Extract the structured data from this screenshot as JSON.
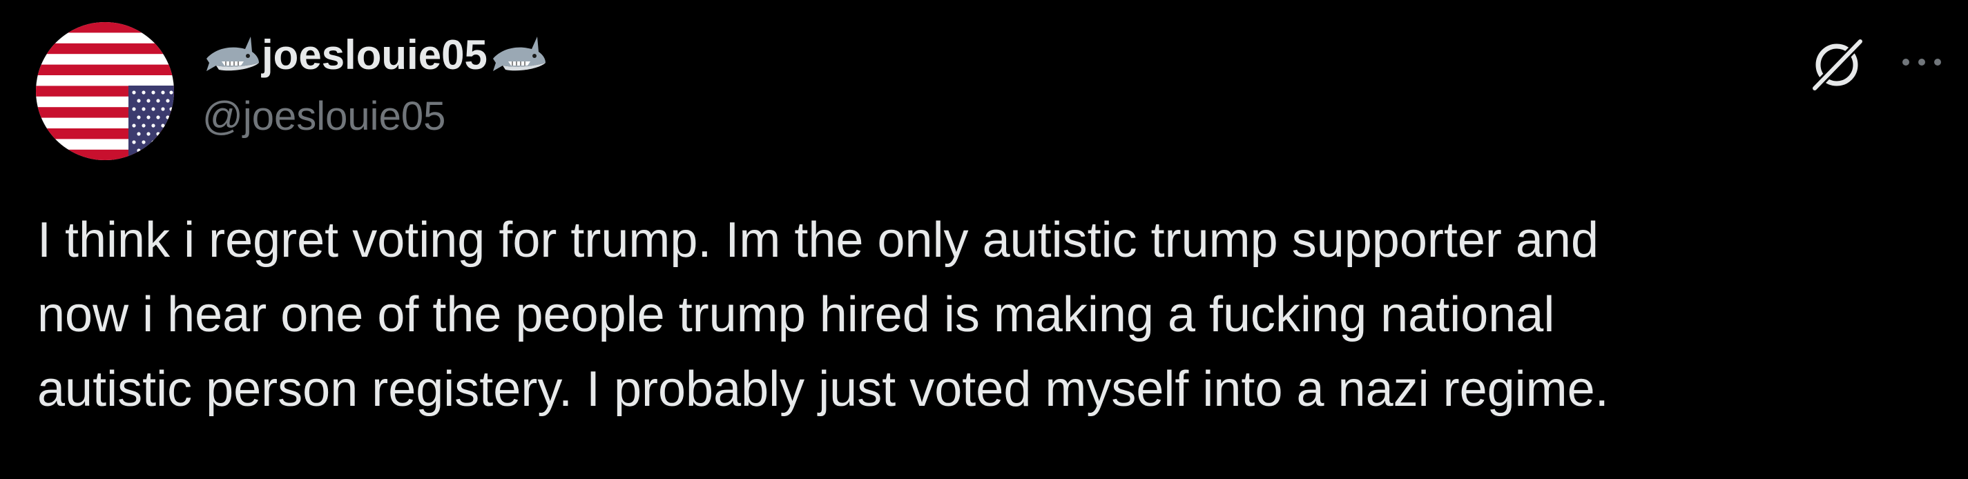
{
  "post": {
    "author": {
      "display_name": "joeslouie05",
      "handle": "@joeslouie05",
      "name_emoji_left": "shark-icon",
      "name_emoji_right": "shark-icon",
      "avatar": "us-flag-avatar"
    },
    "text_lines": [
      "I think i regret voting for trump. Im the only autistic trump supporter and",
      "now i hear one of the people trump hired is making a fucking national",
      "autistic person registery. I probably just voted myself into a nazi regime."
    ],
    "actions": {
      "grok_icon": "grok-icon",
      "more_icon": "more-options-icon"
    }
  },
  "colors": {
    "background": "#000000",
    "primary_text": "#e7e9ea",
    "secondary_text": "#71767b",
    "flag_red": "#c8102e",
    "flag_blue": "#3c3b6e"
  }
}
